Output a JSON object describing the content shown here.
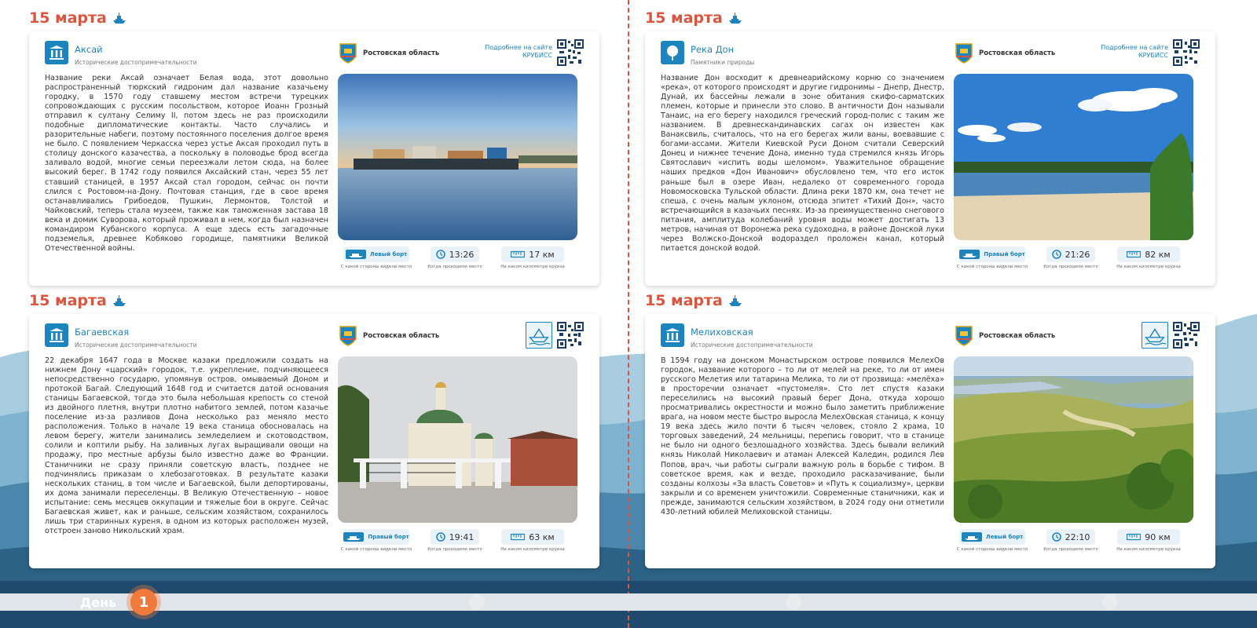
{
  "colors": {
    "accent": "#d9553f",
    "brand_blue": "#1c84bf",
    "wave_dark": "#1f4a6e",
    "day_orange": "#f07a3b"
  },
  "cards": [
    {
      "date": "15 марта",
      "title": "Аксай",
      "category": "Исторические достопримечательности",
      "category_icon": "columns-icon",
      "region": "Ростовская область",
      "more_link": "Подробнее на сайте КРУБИСС",
      "text": "Название реки Аксай означает Белая вода, этот довольно распространенный тюркский гидроним дал название казачьему городку, в 1570 году ставшему местом встречи турецких сопровождающих с русским посольством, которое Иоанн Грозный отправил к султану Селиму II, потом здесь не раз происходили подобные дипломатические контакты. Часто случались и разорительные набеги, поэтому постоянного поселения долгое время не было. С появлением Черкасска через устье Аксая проходил путь в столицу донского казачества, а поскольку в половодье брод всегда заливало водой, многие семьи переезжали летом сюда, на более высокий берег. В 1742 году появился Аксайский стан, через 55 лет ставший станицей, в 1957 Аксай стал городом, сейчас он почти слился с Ростовом-на-Дону. Почтовая станция, где в свое время останавливались Грибоедов, Пушкин, Лермонтов, Толстой и Чайковский, теперь стала музеем, также как таможенная застава 18 века и домик Суворова, который проживал в нем, когда был назначен командиром Кубанского корпуса. А еще здесь есть загадочные подземелья, древнее Кобяково городище, памятники Великой Отечественной войны.",
      "side": "Левый борт",
      "side_label": "С какой стороны видели место",
      "time": "13:26",
      "time_label": "Когда проходили место",
      "km": "17 км",
      "km_label": "На каком километре круиза"
    },
    {
      "date": "15 марта",
      "title": "Река Дон",
      "category": "Памятники природы",
      "category_icon": "tree-icon",
      "region": "Ростовская область",
      "more_link": "Подробнее на сайте КРУБИСС",
      "text": "Название Дон восходит к древнеарийскому корню со значением «река», от которого происходят и другие гидронимы – Днепр, Днестр, Дунай, их бассейны лежали в зоне обитания скифо-сарматских племен, которые и принесли это слово. В античности Дон называли Танаис, на его берегу находился греческий город-полис с таким же названием. В древнескандинавских сагах он известен как Ванаксвиль, считалось, что на его берегах жили ваны, воевавшие с богами-ассами. Жители Киевской Руси Доном считали Северский Донец и нижнее течение Дона, именно туда стремился князь Игорь Святославич «испить воды шеломом». Уважительное обращение наших предков «Дон Иванович» обусловлено тем, что его исток раньше был в озере Иван, недалеко от современного города Новомосковска Тульской области. Длина реки 1870 км, она течет не спеша, с очень малым уклоном, отсюда эпитет «Тихий Дон», часто встречающийся в казачьих песнях. Из-за преимущественно снегового питания, амплитуда колебаний уровня воды может достигать 13 метров, начиная от Воронежа река судоходна, в районе Донской луки через Волжско-Донской водораздел проложен канал, который питается донской водой.",
      "side": "Правый борт",
      "side_label": "С какой стороны видели место",
      "time": "21:26",
      "time_label": "Когда проходили место",
      "km": "82 км",
      "km_label": "На каком километре круиза"
    },
    {
      "date": "15 марта",
      "title": "Багаевская",
      "category": "Исторические достопримечательности",
      "category_icon": "columns-icon",
      "region": "Ростовская область",
      "text": "22 декабря 1647 года в Москве казаки предложили создать на нижнем Дону «царский» городок, т.е. укрепление, подчиняющееся непосредственно государю, упомянув остров, омываемый Доном и протокой Багай. Следующий 1648 год и считается датой основания станицы Багаевской, тогда это была небольшая крепость со стеной из двойного плетня, внутри плотно набитого землей, потом казачье поселение из-за разливов Дона несколько раз меняло место расположения. Только в начале 19 века станица обосновалась на левом берегу, жители занимались земледелием и скотоводством, солили и коптили рыбу. На заливных лугах выращивали овощи на продажу, про местные арбузы было известно даже во Франции. Станичники не сразу приняли советскую власть, позднее не подчинялись приказам о хлебозаготовках. В результате казаки нескольких станиц, в том числе и Багаевской, были депортированы, их дома занимали переселенцы. В Великую Отечественную – новое испытание: семь месяцев оккупации и тяжелые бои в округе. Сейчас Багаевская живет, как и раньше, сельским хозяйством, сохранилось лишь три старинных куреня, в одном из которых расположен музей, отстроен заново Никольский храм.",
      "side": "Правый борт",
      "side_label": "С какой стороны видели место",
      "time": "19:41",
      "time_label": "Когда проходили место",
      "km": "63 км",
      "km_label": "На каком километре круиза"
    },
    {
      "date": "15 марта",
      "title": "Мелиховская",
      "category": "Исторические достопримечательности",
      "category_icon": "columns-icon",
      "region": "Ростовская область",
      "text": "В 1594 году на донском Монастырском острове появился МелехОв городок, название которого – то ли от мелей на реке, то ли от имен русского Мелетия или татарина Мелика, то ли от прозвища: «мелёха» в просторечии означает «пустомеля». Сто лет спустя казаки переселились на высокий правый берег Дона, откуда хорошо просматривались окрестности и можно было заметить приближение врага, на новом месте быстро выросла МелехОвская станица, к концу 19 века здесь жило почти 6 тысяч человек, стояло 2 храма, 10 торговых заведений, 24 мельницы, перепись говорит, что в станице не было ни одного безлошадного хозяйства. Здесь бывали великий князь Николай Николаевич и атаман Алексей Каледин, родился Лев Попов, врач, чьи работы сыграли важную роль в борьбе с тифом. В советское время, как и везде, проходило расказачивание, были созданы колхозы «За власть Советов» и «Путь к социализму», церкви закрыли и со временем уничтожили. Современные станичники, как и прежде, занимаются сельским хозяйством, в 2024 году они отметили 430-летний юбилей Мелиховской станицы.",
      "side": "Левый борт",
      "side_label": "С какой стороны видели место",
      "time": "22:10",
      "time_label": "Когда проходили место",
      "km": "90 км",
      "km_label": "На каком километре круиза"
    }
  ],
  "timeline": {
    "day_label": "День",
    "day_number": "1"
  }
}
